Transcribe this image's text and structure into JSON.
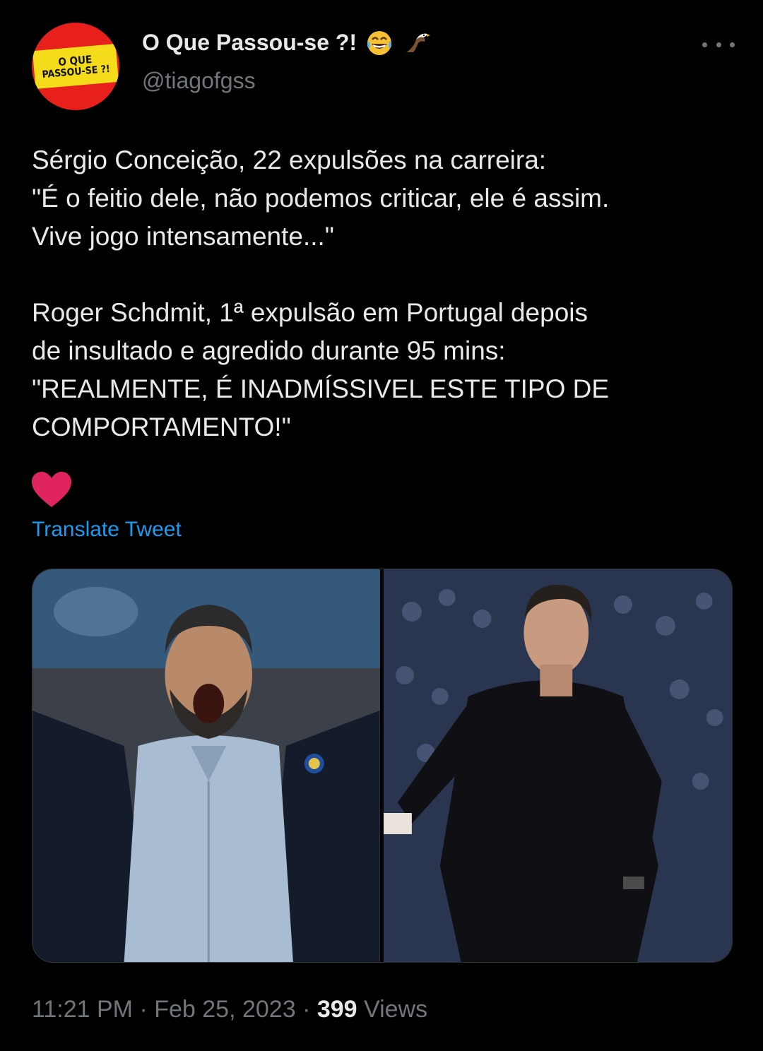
{
  "account": {
    "display_name": "O Que Passou-se ?!",
    "handle": "@tiagofgss",
    "avatar_text": [
      "O QUE",
      "PASSOU-SE ?!"
    ],
    "name_emojis": [
      "face-with-tears-of-joy-emoji",
      "eagle-emoji"
    ]
  },
  "tweet": {
    "lines": [
      "Sérgio Conceição, 22 expulsões na carreira:",
      "\"É o feitio dele, não podemos criticar, ele é assim.",
      "Vive jogo intensamente...\"",
      "",
      "Roger Schdmit, 1ª expulsão em Portugal depois",
      "de insultado e agredido durante 95 mins:",
      "\"REALMENTE, É INADMÍSSIVEL ESTE TIPO DE",
      "COMPORTAMENTO!\""
    ],
    "heart_emoji": "red-heart-emoji",
    "translate_label": "Translate Tweet"
  },
  "media": {
    "photos": [
      "shouting-coach-photo",
      "coach-black-sweater-photo"
    ]
  },
  "meta": {
    "time": "11:21 PM",
    "separator": " · ",
    "date": "Feb 25, 2023",
    "views_count": "399",
    "views_label": " Views"
  },
  "colors": {
    "background": "#000000",
    "text": "#e7e9ea",
    "secondary": "#71767b",
    "link": "#1d9bf0",
    "heart": "#e0245e"
  }
}
